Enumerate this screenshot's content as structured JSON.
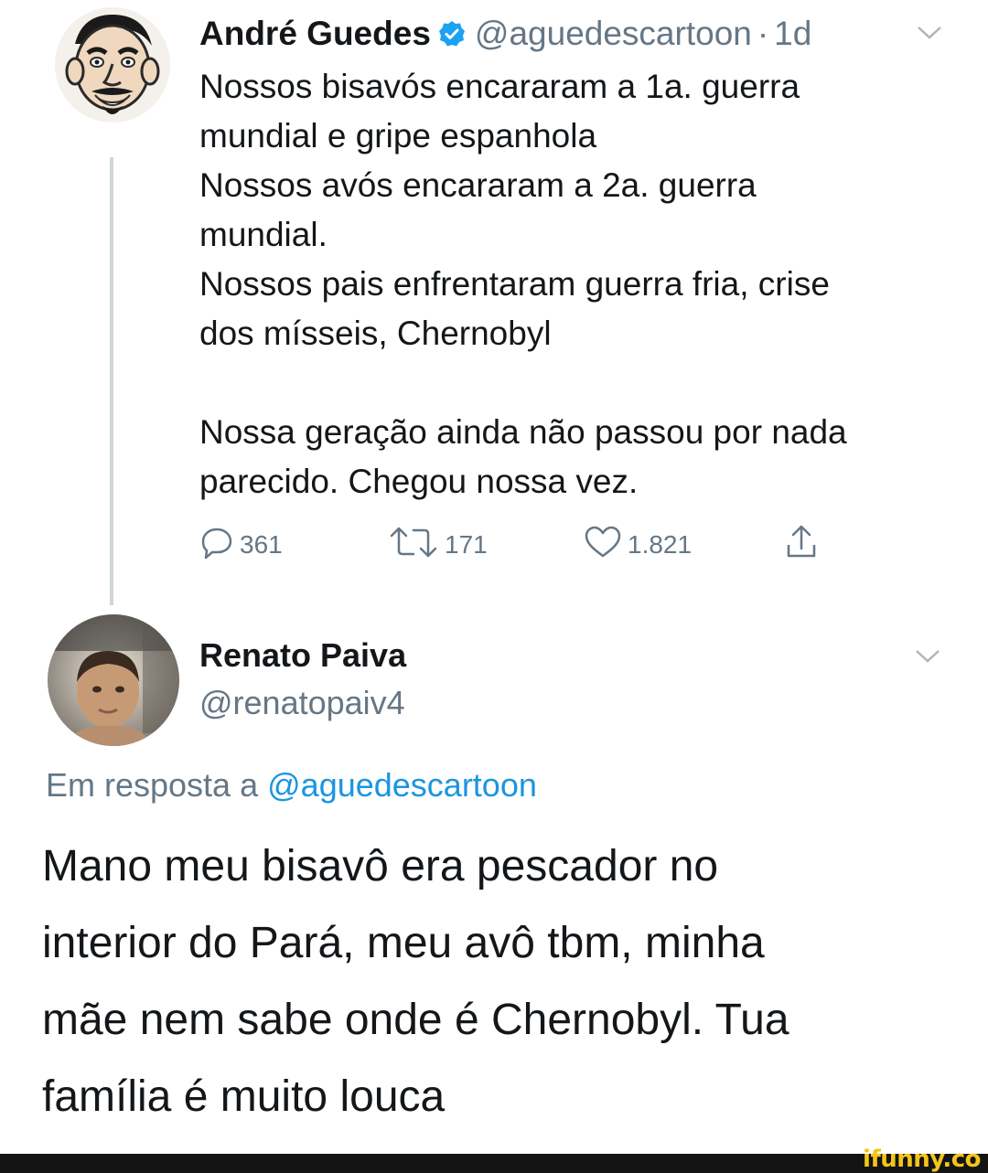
{
  "tweet": {
    "author_name": "André Guedes",
    "author_handle": "@aguedescartoon",
    "separator": "·",
    "time": "1d",
    "lines": [
      "Nossos bisavós encararam a 1a. guerra",
      "mundial e gripe espanhola",
      "Nossos avós encararam a 2a. guerra",
      "mundial.",
      "Nossos pais enfrentaram guerra fria, crise",
      "dos mísseis, Chernobyl",
      "",
      "Nossa geração ainda não passou por nada",
      "parecido. Chegou nossa vez."
    ],
    "replies": "361",
    "retweets": "171",
    "likes": "1.821"
  },
  "reply": {
    "author_name": "Renato Paiva",
    "author_handle": "@renatopaiv4",
    "in_reply_prefix": "Em resposta a",
    "in_reply_mention": "@aguedescartoon",
    "lines": [
      "Mano meu bisavô era pescador no",
      "interior do Pará, meu avô tbm, minha",
      "mãe nem sabe onde é Chernobyl. Tua",
      "família é muito louca"
    ]
  },
  "watermark": "ifunny.co",
  "colors": {
    "text": "#14171a",
    "secondary": "#657786",
    "link": "#1b95e0",
    "verified": "#1da1f2",
    "thread_line": "#cfd6dc",
    "watermark": "#f5c518"
  },
  "icons": [
    "verified-badge-icon",
    "chevron-down-icon",
    "reply-icon",
    "retweet-icon",
    "like-icon",
    "share-icon"
  ]
}
